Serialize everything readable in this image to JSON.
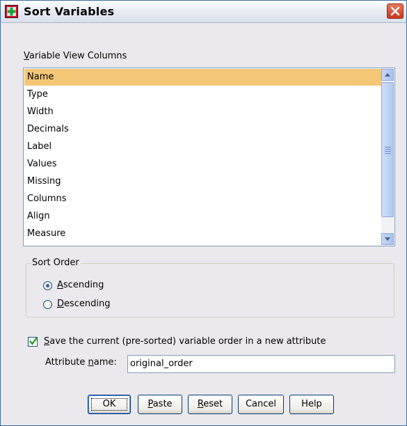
{
  "window": {
    "title": "Sort Variables",
    "close_label": "✕"
  },
  "columns": {
    "label": "Variable View Columns",
    "items": [
      "Name",
      "Type",
      "Width",
      "Decimals",
      "Label",
      "Values",
      "Missing",
      "Columns",
      "Align",
      "Measure"
    ],
    "selected": "Name"
  },
  "sort_order": {
    "label": "Sort Order",
    "options": [
      {
        "label": "Ascending",
        "checked": true
      },
      {
        "label": "Descending",
        "checked": false
      }
    ]
  },
  "save_order": {
    "checked": true,
    "label": "Save the current (pre-sorted) variable order in a new attribute",
    "attribute_label": "Attribute name:",
    "attribute_value": "original_order"
  },
  "buttons": {
    "ok": "OK",
    "paste": "Paste",
    "reset": "Reset",
    "cancel": "Cancel",
    "help": "Help"
  }
}
